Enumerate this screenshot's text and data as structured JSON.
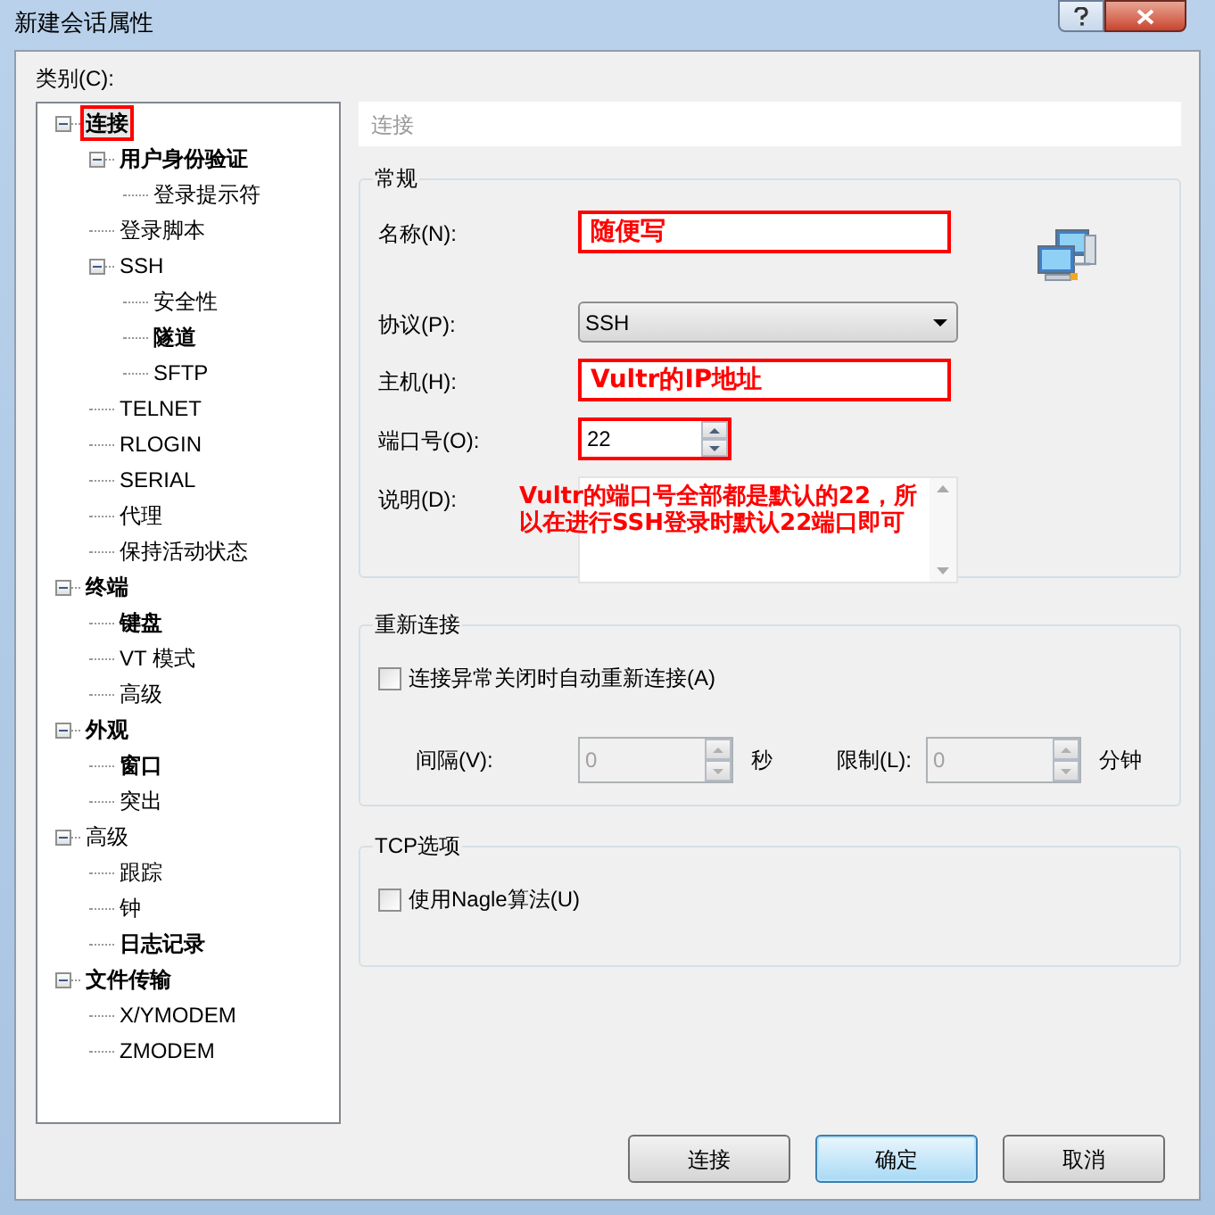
{
  "window": {
    "title": "新建会话属性"
  },
  "category_label": "类别(C):",
  "tree": [
    {
      "label": "连接",
      "bold": true,
      "selected": true,
      "annotated": true,
      "expanded": true,
      "children": [
        {
          "label": "用户身份验证",
          "bold": true,
          "selected": false,
          "annotated": false,
          "expanded": true,
          "children": [
            {
              "label": "登录提示符",
              "bold": false,
              "selected": false,
              "annotated": false
            }
          ]
        },
        {
          "label": "登录脚本",
          "bold": false,
          "selected": false,
          "annotated": false
        },
        {
          "label": "SSH",
          "bold": false,
          "selected": false,
          "annotated": false,
          "expanded": true,
          "children": [
            {
              "label": "安全性",
              "bold": false,
              "selected": false,
              "annotated": false
            },
            {
              "label": "隧道",
              "bold": true,
              "selected": false,
              "annotated": false
            },
            {
              "label": "SFTP",
              "bold": false,
              "selected": false,
              "annotated": false
            }
          ]
        },
        {
          "label": "TELNET",
          "bold": false,
          "selected": false,
          "annotated": false
        },
        {
          "label": "RLOGIN",
          "bold": false,
          "selected": false,
          "annotated": false
        },
        {
          "label": "SERIAL",
          "bold": false,
          "selected": false,
          "annotated": false
        },
        {
          "label": "代理",
          "bold": false,
          "selected": false,
          "annotated": false
        },
        {
          "label": "保持活动状态",
          "bold": false,
          "selected": false,
          "annotated": false
        }
      ]
    },
    {
      "label": "终端",
      "bold": true,
      "selected": false,
      "annotated": false,
      "expanded": true,
      "children": [
        {
          "label": "键盘",
          "bold": true,
          "selected": false,
          "annotated": false
        },
        {
          "label": "VT 模式",
          "bold": false,
          "selected": false,
          "annotated": false
        },
        {
          "label": "高级",
          "bold": false,
          "selected": false,
          "annotated": false
        }
      ]
    },
    {
      "label": "外观",
      "bold": true,
      "selected": false,
      "annotated": false,
      "expanded": true,
      "children": [
        {
          "label": "窗口",
          "bold": true,
          "selected": false,
          "annotated": false
        },
        {
          "label": "突出",
          "bold": false,
          "selected": false,
          "annotated": false
        }
      ]
    },
    {
      "label": "高级",
      "bold": false,
      "selected": false,
      "annotated": false,
      "expanded": true,
      "children": [
        {
          "label": "跟踪",
          "bold": false,
          "selected": false,
          "annotated": false
        },
        {
          "label": "钟",
          "bold": false,
          "selected": false,
          "annotated": false
        },
        {
          "label": "日志记录",
          "bold": true,
          "selected": false,
          "annotated": false
        }
      ]
    },
    {
      "label": "文件传输",
      "bold": true,
      "selected": false,
      "annotated": false,
      "expanded": true,
      "children": [
        {
          "label": "X/YMODEM",
          "bold": false,
          "selected": false,
          "annotated": false
        },
        {
          "label": "ZMODEM",
          "bold": false,
          "selected": false,
          "annotated": false
        }
      ]
    }
  ],
  "page_header": "连接",
  "general": {
    "title": "常规",
    "fields": [
      {
        "kind": "text",
        "label": "名称(N):",
        "value": "随便写",
        "annotated": true
      },
      {
        "kind": "dropdown",
        "label": "协议(P):",
        "value": "SSH",
        "annotated": false
      },
      {
        "kind": "text",
        "label": "主机(H):",
        "value": "Vultr的IP地址",
        "annotated": true
      },
      {
        "kind": "spinner",
        "label": "端口号(O):",
        "value": "22",
        "annotated": true
      },
      {
        "kind": "textarea",
        "label": "说明(D):",
        "annotated": false
      }
    ],
    "annotation_note": "Vultr的端口号全部都是默认的22，所以在进行SSH登录时默认22端口即可"
  },
  "reconnect": {
    "title": "重新连接",
    "checkbox": {
      "label": "连接异常关闭时自动重新连接(A)",
      "checked": false
    },
    "interval": {
      "label": "间隔(V):",
      "value": "0",
      "unit": "秒",
      "disabled": true
    },
    "limit": {
      "label": "限制(L):",
      "value": "0",
      "unit": "分钟",
      "disabled": true
    }
  },
  "tcp": {
    "title": "TCP选项",
    "checkbox": {
      "label": "使用Nagle算法(U)",
      "checked": false
    }
  },
  "buttons": [
    {
      "label": "连接",
      "default": false
    },
    {
      "label": "确定",
      "default": true
    },
    {
      "label": "取消",
      "default": false
    }
  ]
}
